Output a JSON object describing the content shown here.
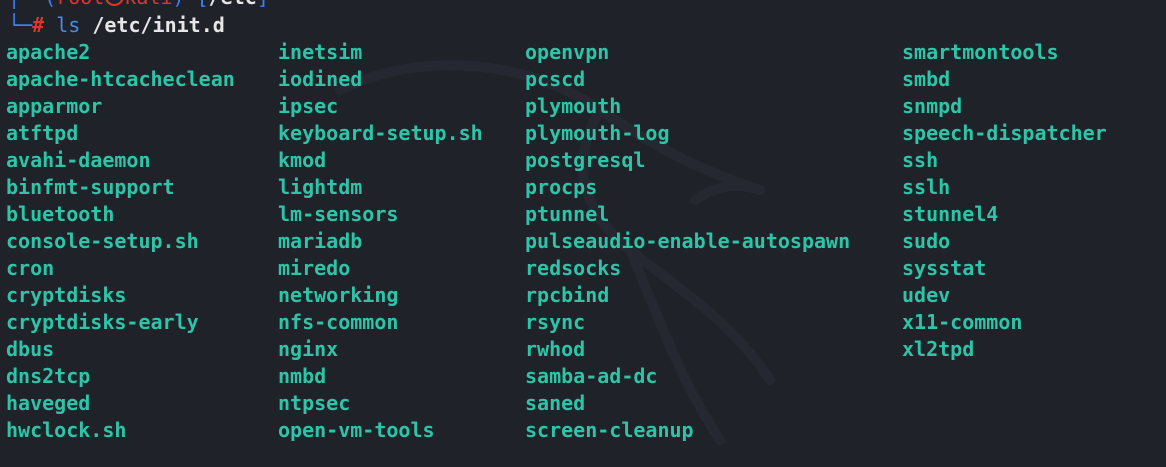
{
  "prompt": {
    "open_paren": "(",
    "user_host": "root㉿kali",
    "close_paren": ")-",
    "open_bracket": "[",
    "cwd": "/etc",
    "close_bracket": "]",
    "symbol": "#",
    "command": "ls",
    "argument": "/etc/init.d"
  },
  "listing": {
    "columns": [
      [
        "apache2",
        "apache-htcacheclean",
        "apparmor",
        "atftpd",
        "avahi-daemon",
        "binfmt-support",
        "bluetooth",
        "console-setup.sh",
        "cron",
        "cryptdisks",
        "cryptdisks-early",
        "dbus",
        "dns2tcp",
        "haveged",
        "hwclock.sh"
      ],
      [
        "inetsim",
        "iodined",
        "ipsec",
        "keyboard-setup.sh",
        "kmod",
        "lightdm",
        "lm-sensors",
        "mariadb",
        "miredo",
        "networking",
        "nfs-common",
        "nginx",
        "nmbd",
        "ntpsec",
        "open-vm-tools"
      ],
      [
        "openvpn",
        "pcscd",
        "plymouth",
        "plymouth-log",
        "postgresql",
        "procps",
        "ptunnel",
        "pulseaudio-enable-autospawn",
        "redsocks",
        "rpcbind",
        "rsync",
        "rwhod",
        "samba-ad-dc",
        "saned",
        "screen-cleanup"
      ],
      [
        "smartmontools",
        "smbd",
        "snmpd",
        "speech-dispatcher",
        "ssh",
        "sslh",
        "stunnel4",
        "sudo",
        "sysstat",
        "udev",
        "x11-common",
        "xl2tpd"
      ]
    ]
  },
  "colors": {
    "background": "#1f2229",
    "entry": "#2ec4a7",
    "prompt_accent": "#3b82f6",
    "root": "#e5322d"
  },
  "icons": {
    "background": "kali-dragon-logo"
  }
}
